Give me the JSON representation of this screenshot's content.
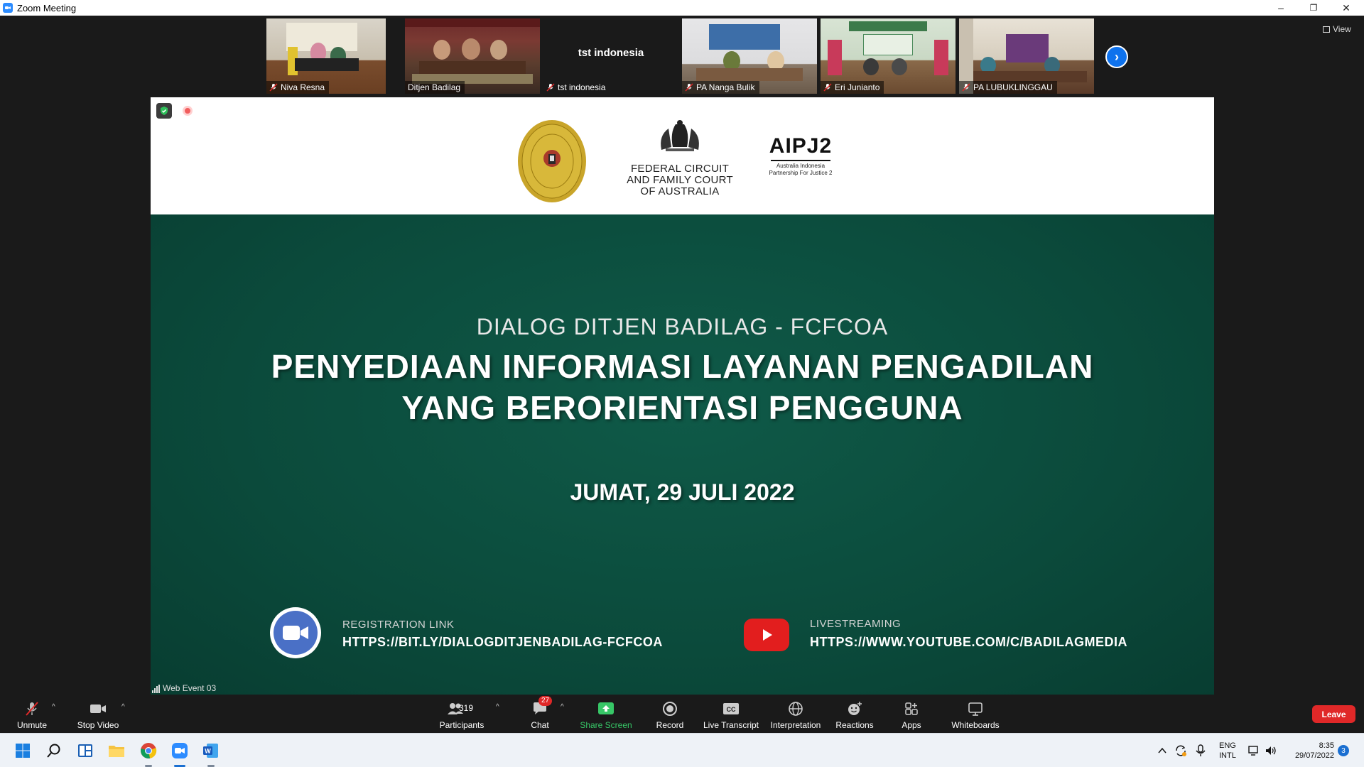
{
  "window": {
    "title": "Zoom Meeting",
    "controls": {
      "minimize": "–",
      "restore": "❐",
      "close": "✕"
    }
  },
  "gallery": {
    "participants": [
      {
        "name": "Niva Resna"
      },
      {
        "name": "Ditjen Badilag"
      },
      {
        "name": "tst indonesia",
        "display_text": "tst indonesia"
      },
      {
        "name": "PA Nanga Bulik"
      },
      {
        "name": "Eri Junianto"
      },
      {
        "name": "PA LUBUKLINGGAU"
      }
    ],
    "view_label": "View"
  },
  "slide": {
    "header": {
      "fcfc_text": "FEDERAL CIRCUIT\nAND FAMILY COURT\nOF AUSTRALIA",
      "aip_big": "AIPJ2",
      "aip_small": "Australia Indonesia\nPartnership For Justice 2"
    },
    "subtitle": "DIALOG DITJEN BADILAG - FCFCOA",
    "title_line1": "PENYEDIAAN INFORMASI LAYANAN PENGADILAN",
    "title_line2": "YANG BERORIENTASI PENGGUNA",
    "date": "JUMAT, 29 JULI 2022",
    "registration_label": "REGISTRATION LINK",
    "registration_link": "HTTPS://BIT.LY/DIALOGDITJENBADILAG-FCFCOA",
    "livestream_label": "LIVESTREAMING",
    "livestream_link": "HTTPS://WWW.YOUTUBE.COM/C/BADILAGMEDIA"
  },
  "connection_label": "Web Event 03",
  "toolbar": {
    "unmute": "Unmute",
    "stop_video": "Stop Video",
    "participants": "Participants",
    "participants_count": "319",
    "chat": "Chat",
    "chat_badge": "27",
    "share_screen": "Share Screen",
    "record": "Record",
    "live_transcript": "Live Transcript",
    "interpretation": "Interpretation",
    "reactions": "Reactions",
    "apps": "Apps",
    "whiteboards": "Whiteboards",
    "leave": "Leave"
  },
  "taskbar": {
    "lang_line1": "ENG",
    "lang_line2": "INTL",
    "time": "8:35",
    "date": "29/07/2022",
    "notifications": "3"
  },
  "colors": {
    "slide_green": "#0d5040",
    "zoom_blue": "#2d8cff",
    "leave_red": "#e02828",
    "share_green": "#37c767"
  }
}
